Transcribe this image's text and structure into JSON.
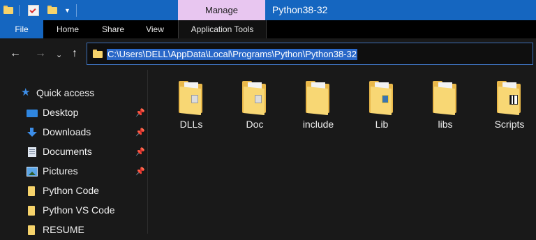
{
  "titlebar": {
    "manage_label": "Manage",
    "window_title": "Python38-32",
    "accent": "#1566c0",
    "manage_color": "#e8c6f0"
  },
  "ribbon": {
    "tabs": [
      {
        "label": "File"
      },
      {
        "label": "Home"
      },
      {
        "label": "Share"
      },
      {
        "label": "View"
      },
      {
        "label": "Application Tools"
      }
    ]
  },
  "nav": {
    "address_path": "C:\\Users\\DELL\\AppData\\Local\\Programs\\Python\\Python38-32"
  },
  "sidebar": {
    "quick_access": "Quick access",
    "items": [
      {
        "label": "Desktop",
        "icon": "desktop-icon",
        "pinned": true
      },
      {
        "label": "Downloads",
        "icon": "download-icon",
        "pinned": true
      },
      {
        "label": "Documents",
        "icon": "documents-icon",
        "pinned": true
      },
      {
        "label": "Pictures",
        "icon": "pictures-icon",
        "pinned": true
      },
      {
        "label": "Python Code",
        "icon": "folder-icon",
        "pinned": false
      },
      {
        "label": "Python VS Code",
        "icon": "folder-icon",
        "pinned": false
      },
      {
        "label": "RESUME",
        "icon": "folder-icon",
        "pinned": false
      }
    ]
  },
  "content": {
    "folders": [
      {
        "label": "DLLs"
      },
      {
        "label": "Doc"
      },
      {
        "label": "include"
      },
      {
        "label": "Lib"
      },
      {
        "label": "libs"
      },
      {
        "label": "Scripts"
      }
    ]
  }
}
